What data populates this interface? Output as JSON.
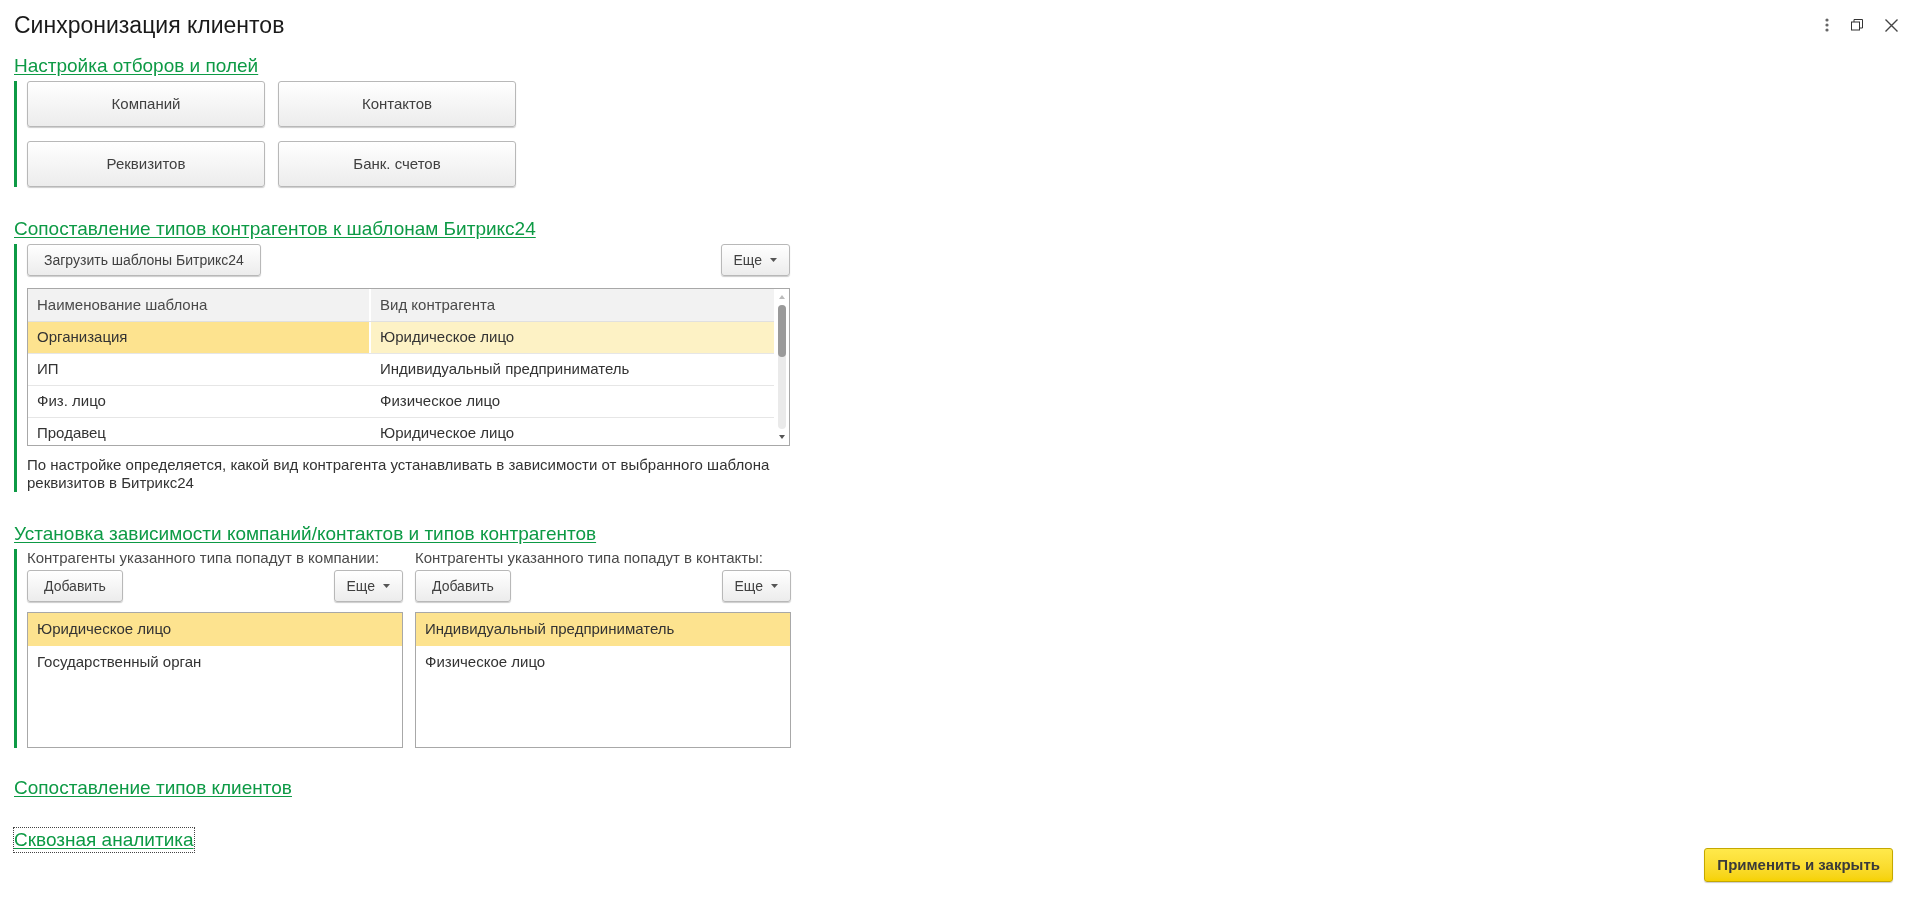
{
  "window": {
    "title": "Синхронизация клиентов"
  },
  "sections": [
    {
      "kind": "buttons",
      "title": "Настройка отборов и полей",
      "buttons": [
        "Компаний",
        "Контактов",
        "Реквизитов",
        "Банк. счетов"
      ]
    },
    {
      "kind": "table",
      "title": "Сопоставление типов контрагентов к шаблонам Битрикс24",
      "load_button": "Загрузить шаблоны Битрикс24",
      "more_button": "Еще",
      "columns": [
        "Наименование шаблона",
        "Вид контрагента"
      ],
      "rows": [
        {
          "cells": [
            "Организация",
            "Юридическое лицо"
          ],
          "selected": true
        },
        {
          "cells": [
            "ИП",
            "Индивидуальный предприниматель"
          ],
          "selected": false
        },
        {
          "cells": [
            "Физ. лицо",
            "Физическое лицо"
          ],
          "selected": false
        },
        {
          "cells": [
            "Продавец",
            "Юридическое лицо"
          ],
          "selected": false
        }
      ],
      "note": "По настройке определяется, какой вид контрагента устанавливать в зависимости от выбранного шаблона реквизитов в Битрикс24"
    },
    {
      "kind": "lists",
      "title": "Установка зависимости компаний/контактов и типов контрагентов",
      "lists": [
        {
          "label": "Контрагенты указанного типа попадут в компании:",
          "add_button": "Добавить",
          "more_button": "Еще",
          "items": [
            {
              "text": "Юридическое лицо",
              "selected": true
            },
            {
              "text": "Государственный орган",
              "selected": false
            }
          ]
        },
        {
          "label": "Контрагенты указанного типа попадут в контакты:",
          "add_button": "Добавить",
          "more_button": "Еще",
          "items": [
            {
              "text": "Индивидуальный предприниматель",
              "selected": true
            },
            {
              "text": "Физическое лицо",
              "selected": false
            }
          ]
        }
      ]
    },
    {
      "kind": "collapsed",
      "title": "Сопоставление типов клиентов",
      "focused": false
    },
    {
      "kind": "collapsed",
      "title": "Сквозная аналитика",
      "focused": true
    }
  ],
  "apply_button": "Применить и закрыть"
}
